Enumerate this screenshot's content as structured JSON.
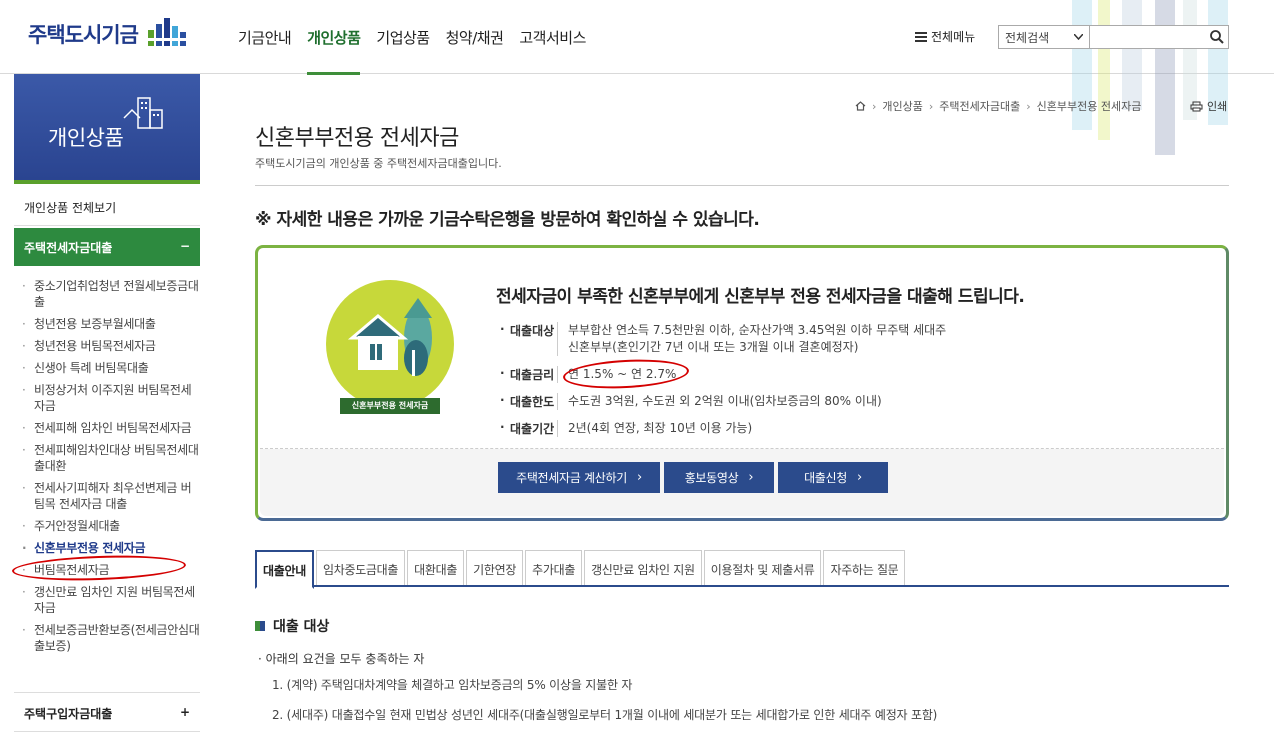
{
  "header": {
    "logo_text": "주택도시기금",
    "gnb": [
      "기금안내",
      "개인상품",
      "기업상품",
      "청약/채권",
      "고객서비스"
    ],
    "gnb_active": "개인상품",
    "allmenu_label": "전체메뉴",
    "search_select": "전체검색"
  },
  "sidebar": {
    "banner_title": "개인상품",
    "all_label": "개인상품 전체보기",
    "group1_label": "주택전세자금대출",
    "group1_toggle": "−",
    "items": [
      "중소기업취업청년 전월세보증금대출",
      "청년전용 보증부월세대출",
      "청년전용 버팀목전세자금",
      "신생아 특례 버팀목대출",
      "비정상거처 이주지원 버팀목전세자금",
      "전세피해 임차인 버팀목전세자금",
      "전세피해임차인대상 버팀목전세대출대환",
      "전세사기피해자 최우선변제금 버팀목 전세자금 대출",
      "주거안정월세대출",
      "신혼부부전용 전세자금",
      "버팀목전세자금",
      "갱신만료 임차인 지원 버팀목전세자금",
      "전세보증금반환보증(전세금안심대출보증)"
    ],
    "active_item": "신혼부부전용 전세자금",
    "group2_label": "주택구입자금대출",
    "group2_toggle": "+"
  },
  "breadcrumb": {
    "items": [
      "개인상품",
      "주택전세자금대출",
      "신혼부부전용 전세자금"
    ],
    "print_label": "인쇄"
  },
  "page": {
    "title": "신혼부부전용 전세자금",
    "desc": "주택도시기금의 개인상품 중 주택전세자금대출입니다.",
    "notice": "※ 자세한 내용은 가까운 기금수탁은행을 방문하여 확인하실 수 있습니다."
  },
  "product": {
    "badge": "신혼부부전용 전세자금",
    "headline": "전세자금이 부족한 신혼부부에게 신혼부부 전용 전세자금을 대출해 드립니다.",
    "rows": [
      {
        "k": "대출대상",
        "v1": "부부합산 연소득 7.5천만원 이하, 순자산가액 3.45억원 이하 무주택 세대주",
        "v2": "신혼부부(혼인기간 7년 이내 또는 3개월 이내 결혼예정자)"
      },
      {
        "k": "대출금리",
        "v1": "연 1.5% ~ 연 2.7%",
        "v2": ""
      },
      {
        "k": "대출한도",
        "v1": "수도권 3억원, 수도권 외 2억원 이내(임차보증금의 80% 이내)",
        "v2": ""
      },
      {
        "k": "대출기간",
        "v1": "2년(4회 연장, 최장 10년 이용 가능)",
        "v2": ""
      }
    ],
    "buttons": [
      "주택전세자금 계산하기",
      "홍보동영상",
      "대출신청"
    ]
  },
  "tabs": [
    "대출안내",
    "임차중도금대출",
    "대환대출",
    "기한연장",
    "추가대출",
    "갱신만료 임차인 지원",
    "이용절차 및 제출서류",
    "자주하는 질문"
  ],
  "section": {
    "title": "대출 대상",
    "condition": "아래의 요건을 모두 충족하는 자",
    "items": [
      "1. (계약) 주택임대차계약을 체결하고 임차보증금의 5% 이상을 지불한 자",
      "2. (세대주) 대출접수일 현재 민법상 성년인 세대주(대출실행일로부터 1개월 이내에 세대분가 또는 세대합가로 인한 세대주 예정자 포함)"
    ]
  }
}
